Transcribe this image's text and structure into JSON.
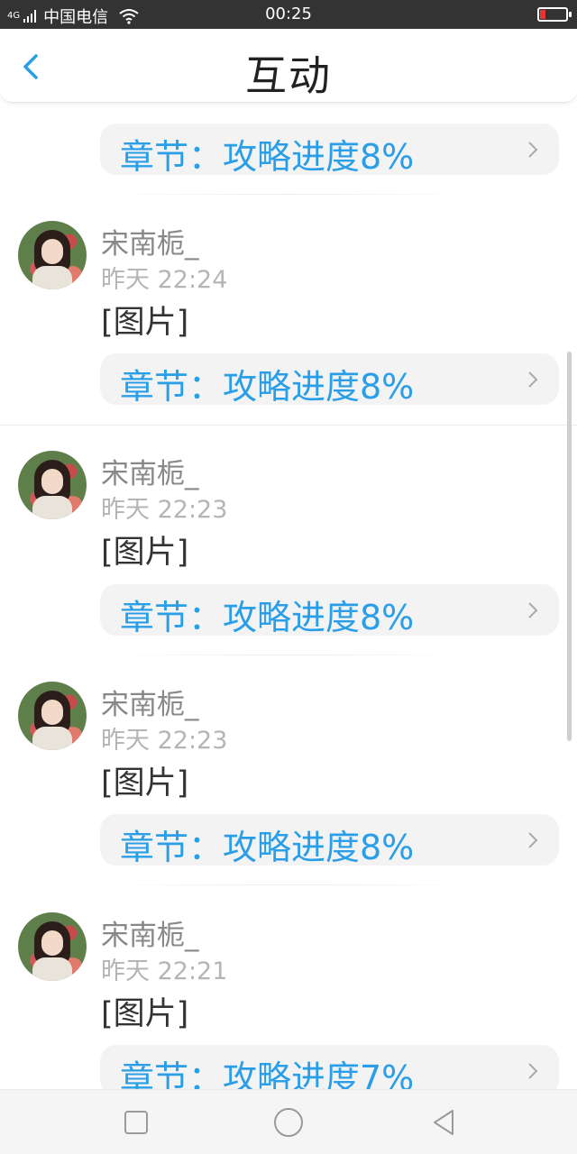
{
  "status_bar": {
    "network": "4G",
    "carrier": "中国电信",
    "time": "00:25"
  },
  "header": {
    "title": "互动",
    "back_icon": "chevron-left-icon"
  },
  "top_chapter": {
    "label": "章节：攻略进度8%"
  },
  "items": [
    {
      "username": "宋南栀_",
      "time": "昨天 22:24",
      "content": "[图片]",
      "chapter": "章节：攻略进度8%"
    },
    {
      "username": "宋南栀_",
      "time": "昨天 22:23",
      "content": "[图片]",
      "chapter": "章节：攻略进度8%"
    },
    {
      "username": "宋南栀_",
      "time": "昨天 22:23",
      "content": "[图片]",
      "chapter": "章节：攻略进度8%"
    },
    {
      "username": "宋南栀_",
      "time": "昨天 22:21",
      "content": "[图片]",
      "chapter": "章节：攻略进度7%"
    }
  ],
  "nav_bar": {
    "recent_icon": "square-icon",
    "home_icon": "circle-icon",
    "back_icon": "triangle-back-icon"
  },
  "colors": {
    "accent": "#2a9ee6",
    "status_bar": "#333333",
    "battery_low": "#e5372f"
  }
}
